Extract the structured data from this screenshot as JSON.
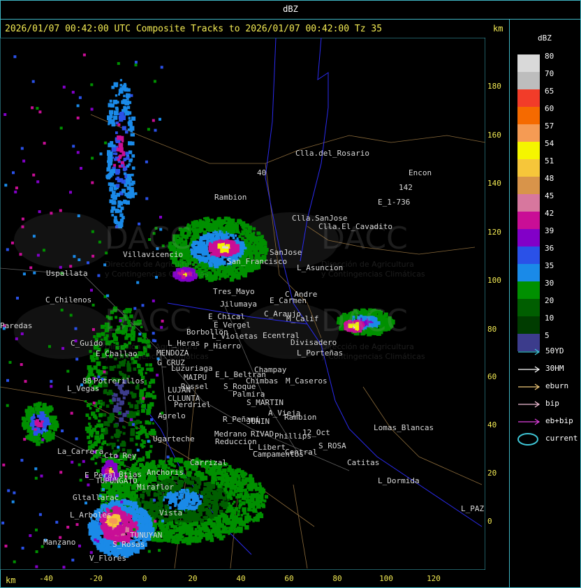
{
  "window": {
    "title": "dBZ"
  },
  "map": {
    "title": "2026/01/07 00:42:00 UTC Composite Tracks to 2026/01/07 00:42:00 Tz 35",
    "unit_top": "km",
    "unit_bottom": "km",
    "y_ticks": [
      "180",
      "160",
      "140",
      "120",
      "100",
      "80",
      "60",
      "40",
      "20",
      "0"
    ],
    "x_ticks": [
      "-40",
      "-20",
      "0",
      "20",
      "40",
      "60",
      "80",
      "100",
      "120"
    ],
    "watermark": {
      "brand": "DACC",
      "line1": "Dirección de Agricultura",
      "line2": "y Contingencias Climáticas"
    },
    "places": [
      "Clla.del_Rosario",
      "Encon",
      "142",
      "E_1-736",
      "Rambion",
      "40",
      "Clla.SanJose",
      "Clla.El_Cavadito",
      "Villavicencio",
      "Uspallata",
      "SanJose",
      "San_Francisco",
      "L_Asuncion",
      "Tres_Mayo",
      "C_Andre",
      "E_Carmen",
      "Jilumaya",
      "C_Chilenos",
      "C_Araujo",
      "M_Calif",
      "E_Chical",
      "E_Vergel",
      "Ecentral",
      "Divisadero",
      "L_Violetas",
      "Borbollon",
      "P_Hierro",
      "Paredas",
      "L_Porteñas",
      "C_Guido",
      "L_Heras",
      "E_Challao",
      "MENDOZA",
      "G_CRUZ",
      "Luzuriaga",
      "Champay",
      "E_L_Beltran",
      "Chimbas",
      "M_Caseros",
      "88",
      "Potrerillos",
      "L_Vegas",
      "MAIPU",
      "Russel",
      "LUJAN",
      "S_Roque",
      "Palmira",
      "CLLUNTA",
      "Perdriel",
      "S_MARTIN",
      "A_Vieja",
      "Rambion",
      "Agrelo",
      "R_Peñami",
      "JUNIN",
      "Ugarteche",
      "RIVAD",
      "Medrano",
      "Reduccion",
      "12_Oct",
      "Phillips",
      "La_Carrera",
      "Cto_Rey",
      "L_Libert",
      "S_ROSA",
      "Lomas_Blancas",
      "Campamentos",
      "Central",
      "Catitas",
      "Carrizal",
      "Anchoris",
      "E_Peral",
      "Btias",
      "TUPUNGATO",
      "Miraflor",
      "Gltallarac",
      "Vista",
      "L_Dormida",
      "L_Arboles",
      "L_PAZ",
      "TUNUYAN",
      "Manzano",
      "S_Rosas",
      "V_Flores"
    ]
  },
  "legend": {
    "title": "dBZ",
    "levels": [
      {
        "label": "80",
        "color": "#d9d9d9"
      },
      {
        "label": "70",
        "color": "#bdbdbd"
      },
      {
        "label": "65",
        "color": "#f23c29"
      },
      {
        "label": "60",
        "color": "#f56a00"
      },
      {
        "label": "57",
        "color": "#f59b54"
      },
      {
        "label": "54",
        "color": "#f5f500"
      },
      {
        "label": "51",
        "color": "#f6c63a"
      },
      {
        "label": "48",
        "color": "#d8944a"
      },
      {
        "label": "45",
        "color": "#d7779e"
      },
      {
        "label": "42",
        "color": "#c90e96"
      },
      {
        "label": "39",
        "color": "#8200c8"
      },
      {
        "label": "36",
        "color": "#2a51e8"
      },
      {
        "label": "35",
        "color": "#1a8ae8"
      },
      {
        "label": "30",
        "color": "#009000"
      },
      {
        "label": "20",
        "color": "#005e00"
      },
      {
        "label": "10",
        "color": "#003c00"
      },
      {
        "label": "5",
        "color": "#3c3c8c"
      }
    ],
    "tracks": [
      {
        "label": "50YD",
        "color": "#3fc6d6"
      },
      {
        "label": "30HM",
        "color": "#ffffff"
      },
      {
        "label": "eburn",
        "color": "#f0c878"
      },
      {
        "label": "bip",
        "color": "#f4c0d8"
      },
      {
        "label": "eb+bip",
        "color": "#e040e0"
      },
      {
        "label": "current",
        "color": "#3fc6d6"
      }
    ]
  }
}
